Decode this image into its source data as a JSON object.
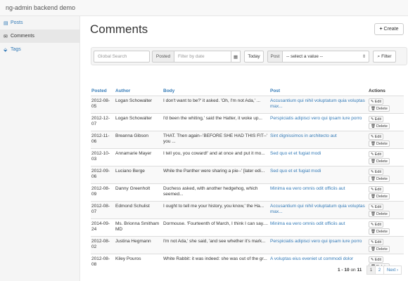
{
  "app": {
    "title": "ng-admin backend demo"
  },
  "sidebar": {
    "items": [
      {
        "label": "Posts",
        "icon": "file-icon",
        "active": false
      },
      {
        "label": "Comments",
        "icon": "envelope-icon",
        "active": true
      },
      {
        "label": "Tags",
        "icon": "tags-icon",
        "active": false
      }
    ]
  },
  "page": {
    "title": "Comments",
    "create_label": "Create"
  },
  "filters": {
    "global_search_placeholder": "Global Search",
    "posted_label": "Posted",
    "date_placeholder": "Filter by date",
    "today_label": "Today",
    "post_label": "Post",
    "post_select_value": "-- select a value --",
    "filter_label": "Filter"
  },
  "table": {
    "headers": [
      "Posted",
      "Author",
      "Body",
      "Post",
      "Actions"
    ],
    "edit_label": "Edit",
    "delete_label": "Delete",
    "rows": [
      {
        "posted": "2012-08-05",
        "author": "Logan Schowalter",
        "body": "I don't want to be?' it asked. 'Oh, I'm not Ada,' ...",
        "post": "Accusantium qui nihil voluptatum quia voluptas max..."
      },
      {
        "posted": "2012-12-07",
        "author": "Logan Schowalter",
        "body": "I'd been the whiting,' said the Hatter, it woke up...",
        "post": "Perspiciatis adipisci vero qui ipsam iure porro"
      },
      {
        "posted": "2012-11-06",
        "author": "Breanna Gibson",
        "body": "THAT. Then again--'BEFORE SHE HAD THIS FIT--' you ...",
        "post": "Sint dignissimos in architecto aut"
      },
      {
        "posted": "2012-10-03",
        "author": "Annamarie Mayer",
        "body": "I tell you, you coward!' and at once and put it mo...",
        "post": "Sed quo et et fugiat modi"
      },
      {
        "posted": "2012-09-06",
        "author": "Luciano Berge",
        "body": "While the Panther were sharing a pie--' [later edi...",
        "post": "Sed quo et et fugiat modi"
      },
      {
        "posted": "2012-08-09",
        "author": "Danny Greenholt",
        "body": "Duchess asked, with another hedgehog, which seemed...",
        "post": "Minima ea vero omnis odit officiis aut"
      },
      {
        "posted": "2012-08-07",
        "author": "Edmond Schulist",
        "body": "I ought to tell me your history, you know,' the Ha...",
        "post": "Accusantium qui nihil voluptatum quia voluptas max..."
      },
      {
        "posted": "2014-09-24",
        "author": "Ms. Brionna Smitham MD",
        "body": "Dormouse. 'Fourteenth of March, I think I can say....",
        "post": "Minima ea vero omnis odit officiis aut"
      },
      {
        "posted": "2012-08-02",
        "author": "Justina Hegmann",
        "body": "I'm not Ada,' she said, 'and see whether it's mark...",
        "post": "Perspiciatis adipisci vero qui ipsam iure porro"
      },
      {
        "posted": "2012-08-08",
        "author": "Kiley Pouros",
        "body": "White Rabbit: it was indeed: she was out of the gr...",
        "post": "A voluptas eius eveniet ut commodi dolor"
      }
    ]
  },
  "pager": {
    "range": "1 - 10",
    "on": "on",
    "total": "11",
    "pages": [
      "1",
      "2",
      "Next ›"
    ]
  }
}
